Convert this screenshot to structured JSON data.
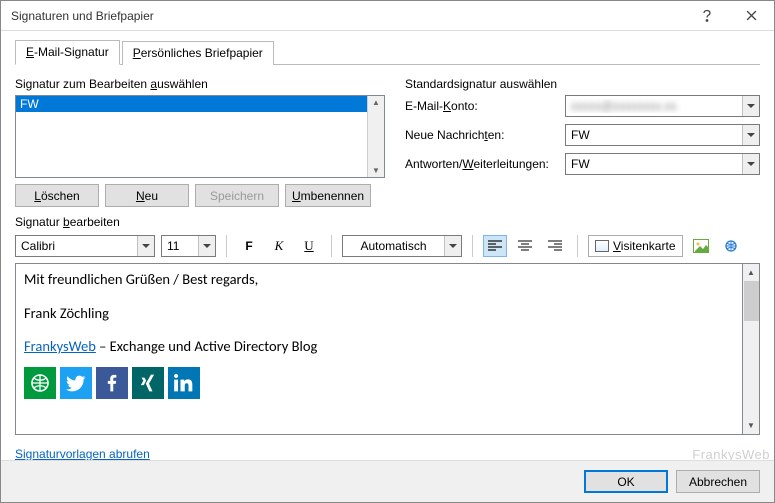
{
  "window": {
    "title": "Signaturen und Briefpapier"
  },
  "tabs": {
    "email_prefix": "E",
    "email_rest": "-Mail-Signatur",
    "stationery_prefix": "P",
    "stationery_rest": "ersönliches Briefpapier"
  },
  "left": {
    "group_label_pre": "Signatur zum Bearbeiten ",
    "group_label_u": "a",
    "group_label_post": "uswählen",
    "selected_item": "FW",
    "buttons": {
      "delete_u": "L",
      "delete_rest": "öschen",
      "new_u": "N",
      "new_rest": "eu",
      "save": "Speichern",
      "rename_u": "U",
      "rename_rest": "mbenennen"
    }
  },
  "right": {
    "group_label": "Standardsignatur auswählen",
    "account_label_pre": "E-Mail-",
    "account_label_u": "K",
    "account_label_post": "onto:",
    "account_value": "xxxxx@xxxxxxxx.xx",
    "new_label_pre": "Neue Nachrich",
    "new_label_u": "t",
    "new_label_post": "en:",
    "new_value": "FW",
    "reply_label_pre": "Antworten/",
    "reply_label_u": "W",
    "reply_label_post": "eiterleitungen:",
    "reply_value": "FW"
  },
  "edit_label_pre": "Signatur ",
  "edit_label_u": "b",
  "edit_label_post": "earbeiten",
  "toolbar": {
    "font": "Calibri",
    "size": "11",
    "bold": "F",
    "italic": "K",
    "underline": "U",
    "color_label": "Automatisch",
    "vcard_u": "V",
    "vcard_rest": "isitenkarte"
  },
  "editor": {
    "line1": "Mit freundlichen Grüßen / Best regards,",
    "line2": "Frank Zöchling",
    "blog_link": "FrankysWeb",
    "blog_rest": " – Exchange und Active Directory Blog"
  },
  "templates_link": "Signaturvorlagen abrufen",
  "footer": {
    "ok": "OK",
    "cancel": "Abbrechen"
  },
  "watermark": "FrankysWeb"
}
